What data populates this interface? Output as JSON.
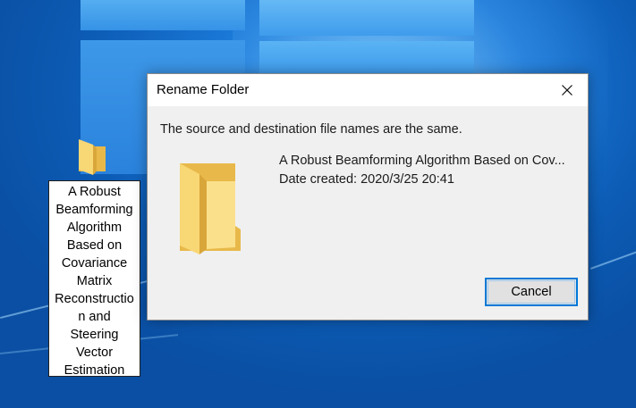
{
  "desktop": {
    "icon": {
      "name": "folder-icon",
      "label_lines": [
        "A Robust",
        "Beamforming",
        "Algorithm",
        "Based on",
        "Covariance",
        "Matrix",
        "Reconstructio",
        "n and",
        "Steering",
        "Vector",
        "Estimation"
      ]
    }
  },
  "dialog": {
    "title": "Rename Folder",
    "close_icon": "close-icon",
    "message": "The source and destination file names are the same.",
    "item": {
      "icon": "folder-icon",
      "name": "A Robust Beamforming Algorithm Based on Cov...",
      "date_created": "Date created: 2020/3/25 20:41"
    },
    "cancel_label": "Cancel"
  },
  "colors": {
    "desktop_blue": "#0c5bb4",
    "accent": "#0078d7",
    "folder_front": "#f8d775",
    "folder_back": "#e8b94a"
  }
}
